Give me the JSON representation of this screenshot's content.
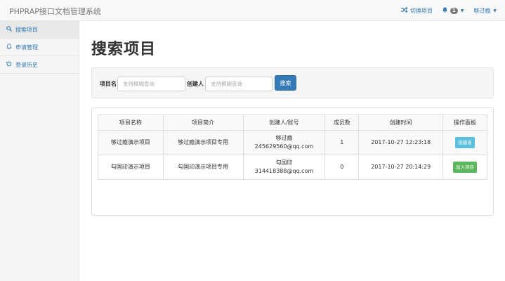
{
  "app": {
    "title": "PHPRAP接口文档管理系统"
  },
  "navbar": {
    "switch_project": "切换项目",
    "notifications_count": "1",
    "user_name": "够过瘾"
  },
  "sidebar": {
    "items": [
      {
        "label": "搜索项目",
        "icon": "search-icon",
        "active": true
      },
      {
        "label": "申请管理",
        "icon": "bell-icon"
      },
      {
        "label": "登录历史",
        "icon": "history-icon"
      }
    ]
  },
  "page": {
    "title": "搜索项目"
  },
  "search": {
    "project_name_label": "项目名",
    "project_name_placeholder": "支持模糊查询",
    "creator_label": "创建人",
    "creator_placeholder": "支持模糊查询",
    "submit_label": "搜索"
  },
  "table": {
    "headers": [
      "项目名称",
      "项目简介",
      "创建人/账号",
      "成员数",
      "创建时间",
      "操作面板"
    ],
    "rows": [
      {
        "name": "够过瘾演示项目",
        "desc": "够过瘾演示项目专用",
        "creator": "够过瘾",
        "account": "245629560@qq.com",
        "members": "1",
        "created": "2017-10-27 12:23:18",
        "action": "创建者"
      },
      {
        "name": "勾国印演示项目",
        "desc": "勾国印演示项目专用",
        "creator": "勾国印",
        "account": "314418388@qq.com",
        "members": "0",
        "created": "2017-10-27 20:14:29",
        "action": "加入项目"
      }
    ]
  },
  "colors": {
    "primary": "#337ab7",
    "info_label": "#5bc0de",
    "success_label": "#5cb85c",
    "navbar_bg": "#f8f8f8"
  }
}
